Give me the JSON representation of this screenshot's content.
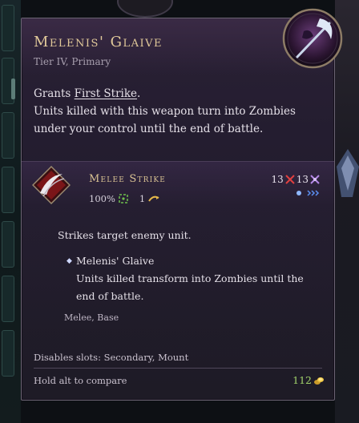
{
  "item": {
    "name": "Melenis' Glaive",
    "subtitle": "Tier IV, Primary",
    "description": {
      "prefix": "Grants ",
      "keyword": "First Strike",
      "suffix": ".",
      "line2": "Units killed with this weapon turn into Zombies under your control until the end of battle."
    }
  },
  "ability": {
    "name": "Melee Strike",
    "accuracy": "100%",
    "cooldown": "1",
    "damage_physical": "13",
    "damage_arcane": "13",
    "effect": "Strikes target enemy unit.",
    "sub_name": "Melenis' Glaive",
    "sub_text": "Units killed transform into Zombies until the end of battle.",
    "tags": "Melee, Base"
  },
  "footer": {
    "disables": "Disables slots: Secondary, Mount",
    "compare_hint": "Hold alt to compare",
    "cost": "112"
  },
  "colors": {
    "title_gold": "#e1c99a",
    "cost_green": "#9fd06a",
    "panel_bg": "#241d30"
  },
  "icons": [
    "glaive-icon",
    "melee-strike-icon",
    "accuracy-icon",
    "cooldown-icon",
    "physical-damage-icon",
    "arcane-damage-icon",
    "range-icon",
    "gold-icon"
  ]
}
